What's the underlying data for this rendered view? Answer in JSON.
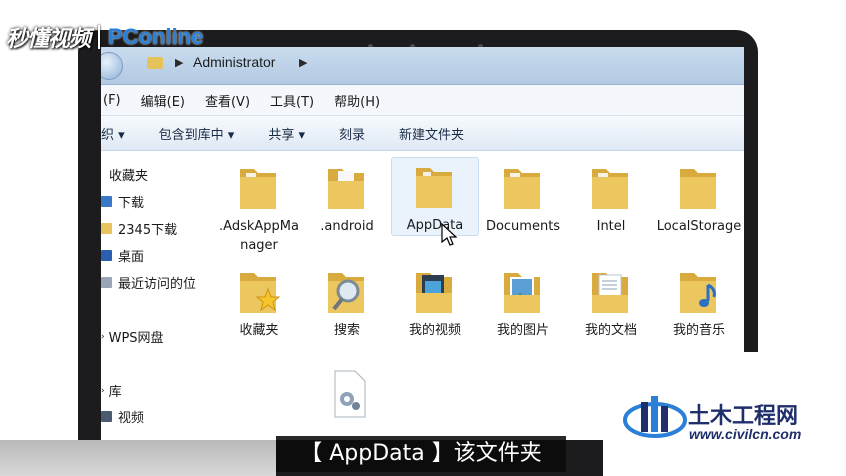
{
  "branding": {
    "left_logo_text": "秒懂视频",
    "pc_logo_text": "PConline",
    "watermark_title": "土木工程网",
    "watermark_url": "www.civilcn.com"
  },
  "address_bar": {
    "path": "Administrator"
  },
  "menu": [
    "(F)",
    "编辑(E)",
    "查看(V)",
    "工具(T)",
    "帮助(H)"
  ],
  "toolbar": {
    "organize": "织 ▾",
    "include_library": "包含到库中 ▾",
    "share": "共享 ▾",
    "burn": "刻录",
    "new_folder": "新建文件夹"
  },
  "nav_pane": {
    "favorites": "收藏夹",
    "downloads": "下载",
    "downloads_2345": "2345下载",
    "desktop": "桌面",
    "recent": "最近访问的位",
    "wps_cloud": "WPS网盘",
    "libraries": "库",
    "videos": "视频"
  },
  "files": [
    {
      "name": ".AdskAppManager",
      "icon": "folder-icon"
    },
    {
      "name": ".android",
      "icon": "folder-icon"
    },
    {
      "name": "AppData",
      "icon": "folder-icon"
    },
    {
      "name": "Documents",
      "icon": "folder-icon"
    },
    {
      "name": "Intel",
      "icon": "folder-icon"
    },
    {
      "name": "LocalStorage",
      "icon": "folder-icon"
    },
    {
      "name": "收藏夹",
      "icon": "favorites-folder-icon"
    },
    {
      "name": "搜索",
      "icon": "search-folder-icon"
    },
    {
      "name": "我的视频",
      "icon": "videos-folder-icon"
    },
    {
      "name": "我的图片",
      "icon": "pictures-folder-icon"
    },
    {
      "name": "我的文档",
      "icon": "documents-folder-icon"
    },
    {
      "name": "我的音乐",
      "icon": "music-folder-icon"
    },
    {
      "name": "",
      "icon": "settings-file-icon"
    }
  ],
  "subtitle": "【 AppData 】该文件夹",
  "colors": {
    "folder": "#e9c35b",
    "pc_logo": "#2a7fd6",
    "watermark": "#1f2f6b"
  }
}
